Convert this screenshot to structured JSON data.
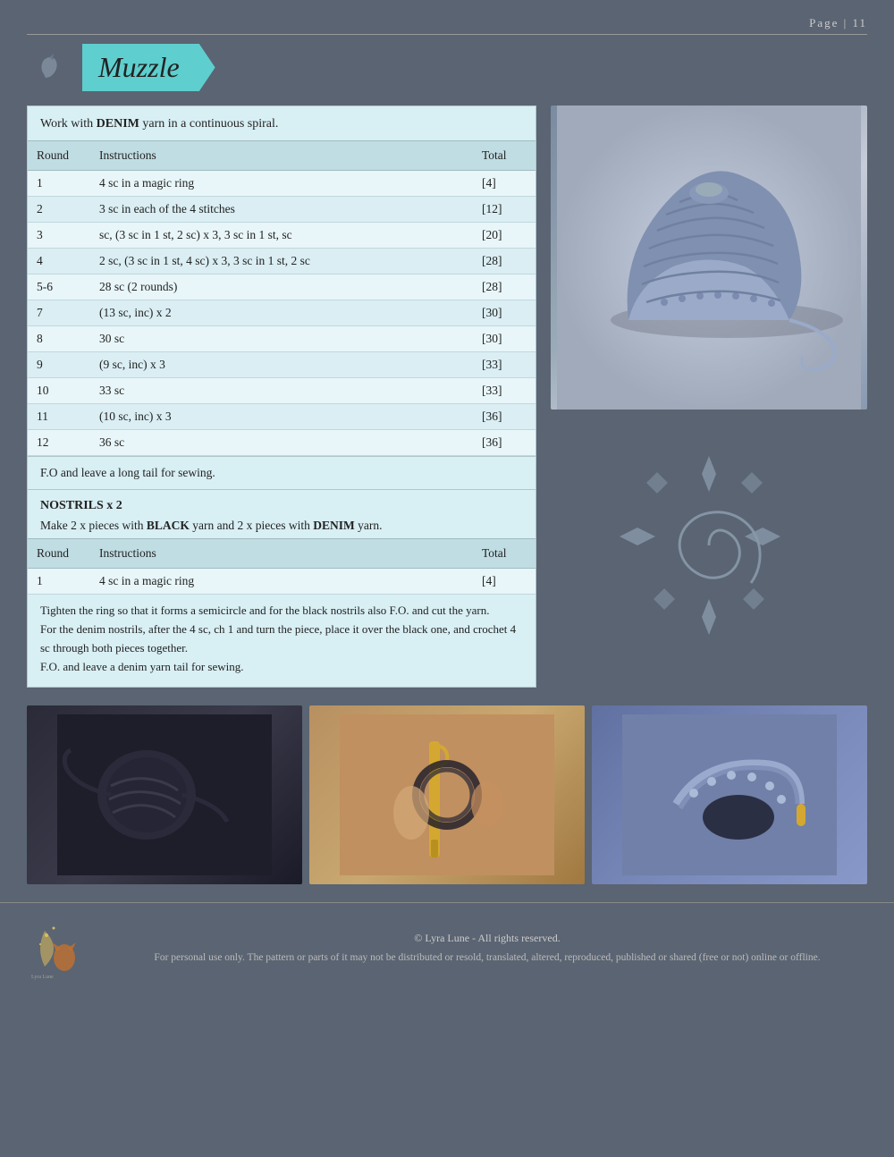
{
  "page": {
    "number": "Page  |  11"
  },
  "title": {
    "text": "Muzzle"
  },
  "main_intro": "Work with DENIM yarn in a continuous spiral.",
  "main_intro_bold": "DENIM",
  "table": {
    "headers": [
      "Round",
      "Instructions",
      "Total"
    ],
    "rows": [
      {
        "round": "1",
        "instructions": "4 sc in a magic ring",
        "total": "[4]"
      },
      {
        "round": "2",
        "instructions": "3 sc in each of the 4 stitches",
        "total": "[12]"
      },
      {
        "round": "3",
        "instructions": "sc, (3 sc in 1 st, 2 sc) x 3, 3 sc in 1 st, sc",
        "total": "[20]"
      },
      {
        "round": "4",
        "instructions": "2 sc, (3 sc in 1 st, 4 sc) x 3, 3 sc in 1 st, 2 sc",
        "total": "[28]"
      },
      {
        "round": "5-6",
        "instructions": "28 sc (2 rounds)",
        "total": "[28]"
      },
      {
        "round": "7",
        "instructions": "(13 sc, inc) x 2",
        "total": "[30]"
      },
      {
        "round": "8",
        "instructions": "30 sc",
        "total": "[30]"
      },
      {
        "round": "9",
        "instructions": "(9 sc, inc) x 3",
        "total": "[33]"
      },
      {
        "round": "10",
        "instructions": "33 sc",
        "total": "[33]"
      },
      {
        "round": "11",
        "instructions": "(10 sc, inc) x 3",
        "total": "[36]"
      },
      {
        "round": "12",
        "instructions": "36 sc",
        "total": "[36]"
      }
    ]
  },
  "fo_note": "F.O and leave a long tail for sewing.",
  "nostrils": {
    "title": "NOSTRILS x 2",
    "intro_part1": "Make 2 x pieces with ",
    "intro_bold1": "BLACK",
    "intro_part2": " yarn and 2 x pieces with ",
    "intro_bold2": "DENIM",
    "intro_part3": " yarn.",
    "table_headers": [
      "Round",
      "Instructions",
      "Total"
    ],
    "table_rows": [
      {
        "round": "1",
        "instructions": "4 sc in a magic ring",
        "total": "[4]"
      }
    ],
    "note_lines": [
      "Tighten the ring so that it forms a semicircle and for the black nostrils also F.O. and cut the yarn.",
      "For the denim nostrils, after the 4 sc, ch 1 and turn the piece, place it over the black one, and crochet 4 sc through both pieces together.",
      "F.O. and leave a denim yarn tail for sewing."
    ]
  },
  "footer": {
    "copyright": "© Lyra Lune - All rights reserved.",
    "legal": "For personal use only. The pattern or parts of it may not be distributed or resold, translated, altered, reproduced, published or shared (free or not) online or offline."
  }
}
